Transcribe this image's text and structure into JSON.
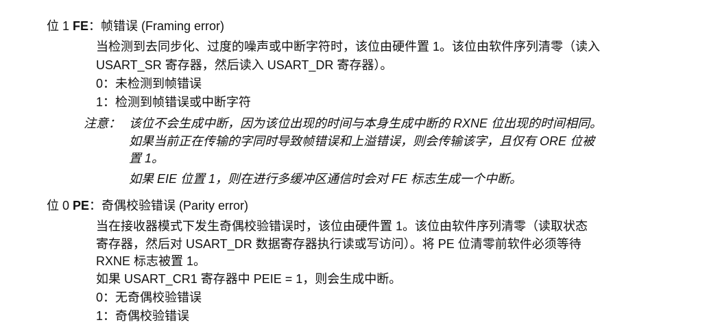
{
  "bit1": {
    "prefix": "位 1 ",
    "name": "FE",
    "title": "：帧错误 (Framing error)",
    "desc": [
      "当检测到去同步化、过度的噪声或中断字符时，该位由硬件置 1。该位由软件序列清零（读入",
      "USART_SR 寄存器，然后读入 USART_DR 寄存器）。"
    ],
    "values": [
      "0：未检测到帧错误",
      "1：检测到帧错误或中断字符"
    ],
    "note_label": "注意：",
    "notes": [
      "该位不会生成中断，因为该位出现的时间与本身生成中断的 RXNE 位出现的时间相同。",
      "如果当前正在传输的字同时导致帧错误和上溢错误，则会传输该字，且仅有 ORE 位被",
      "置 1。",
      "如果 EIE 位置 1，则在进行多缓冲区通信时会对 FE 标志生成一个中断。"
    ]
  },
  "bit0": {
    "prefix": "位 0 ",
    "name": "PE",
    "title": "：奇偶校验错误 (Parity error)",
    "desc": [
      "当在接收器模式下发生奇偶校验错误时，该位由硬件置 1。该位由软件序列清零（读取状态",
      "寄存器，然后对 USART_DR 数据寄存器执行读或写访问）。将 PE 位清零前软件必须等待",
      "RXNE 标志被置 1。",
      "如果 USART_CR1 寄存器中 PEIE = 1，则会生成中断。"
    ],
    "values": [
      "0：无奇偶校验错误",
      "1：奇偶校验错误"
    ]
  }
}
